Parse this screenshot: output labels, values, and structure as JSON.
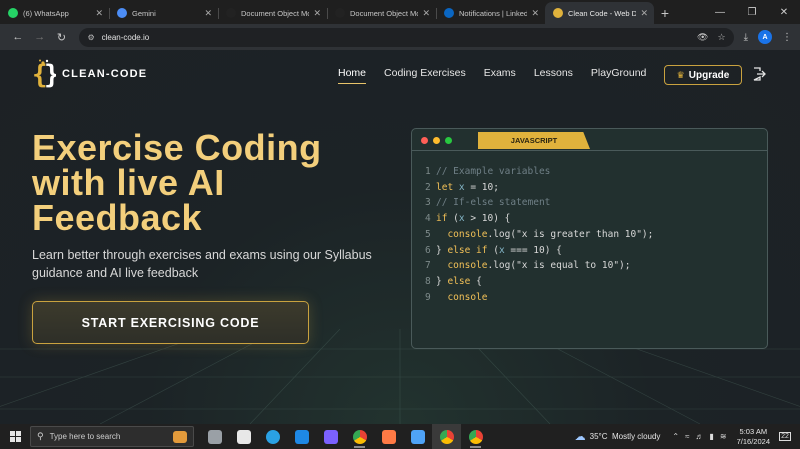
{
  "browser": {
    "tabs": [
      {
        "title": "(6) WhatsApp",
        "favicon": "whatsapp-icon",
        "color": "#25d366",
        "active": false
      },
      {
        "title": "Gemini",
        "favicon": "gemini-icon",
        "color": "#4c8df6",
        "active": false
      },
      {
        "title": "Document Object Mo",
        "favicon": "medium-icon",
        "color": "#222222",
        "active": false
      },
      {
        "title": "Document Object Mo",
        "favicon": "medium-icon",
        "color": "#222222",
        "active": false
      },
      {
        "title": "Notifications | Linked",
        "favicon": "linkedin-icon",
        "color": "#0a66c2",
        "active": false
      },
      {
        "title": "Clean Code - Web De",
        "favicon": "clean-code-icon",
        "color": "#e0b23c",
        "active": true
      }
    ],
    "url": "clean-code.io",
    "profile_initial": "A"
  },
  "site": {
    "logo_text": "CLEAN-CODE",
    "nav": [
      {
        "label": "Home",
        "active": true
      },
      {
        "label": "Coding Exercises",
        "active": false
      },
      {
        "label": "Exams",
        "active": false
      },
      {
        "label": "Lessons",
        "active": false
      },
      {
        "label": "PlayGround",
        "active": false
      }
    ],
    "upgrade_label": "Upgrade",
    "hero": {
      "title_lines": [
        "Exercise Coding",
        "with live AI",
        "Feedback"
      ],
      "subtitle": "Learn better through exercises and exams using our Syllabus guidance and AI live feedback",
      "cta_label": "START EXERCISING CODE"
    },
    "editor": {
      "language_tab": "JAVASCRIPT",
      "dots": [
        "#ff5f57",
        "#febc2e",
        "#28c840"
      ],
      "lines": [
        {
          "n": "1",
          "tokens": [
            {
              "t": "// Example variables",
              "c": "cm"
            }
          ]
        },
        {
          "n": "2",
          "tokens": [
            {
              "t": "let ",
              "c": "kw"
            },
            {
              "t": "x",
              "c": "vr"
            },
            {
              "t": " = 10;",
              "c": "st"
            }
          ]
        },
        {
          "n": "3",
          "tokens": [
            {
              "t": "// If-else statement",
              "c": "cm"
            }
          ]
        },
        {
          "n": "4",
          "tokens": [
            {
              "t": "if",
              "c": "kw"
            },
            {
              "t": " (",
              "c": "st"
            },
            {
              "t": "x",
              "c": "vr"
            },
            {
              "t": " > 10) {",
              "c": "st"
            }
          ]
        },
        {
          "n": "5",
          "tokens": [
            {
              "t": "  console",
              "c": "kw"
            },
            {
              "t": ".log(\"x is greater than 10\");",
              "c": "st"
            }
          ]
        },
        {
          "n": "6",
          "tokens": [
            {
              "t": "} ",
              "c": "st"
            },
            {
              "t": "else if",
              "c": "kw"
            },
            {
              "t": " (",
              "c": "st"
            },
            {
              "t": "x",
              "c": "vr"
            },
            {
              "t": " === 10) {",
              "c": "st"
            }
          ]
        },
        {
          "n": "7",
          "tokens": [
            {
              "t": "  console",
              "c": "kw"
            },
            {
              "t": ".log(\"x is equal to 10\");",
              "c": "st"
            }
          ]
        },
        {
          "n": "8",
          "tokens": [
            {
              "t": "} ",
              "c": "st"
            },
            {
              "t": "else",
              "c": "kw"
            },
            {
              "t": " {",
              "c": "st"
            }
          ]
        },
        {
          "n": "9",
          "tokens": [
            {
              "t": "  console",
              "c": "kw"
            }
          ]
        }
      ]
    },
    "accent_color": "#e0b23c"
  },
  "taskbar": {
    "search_placeholder": "Type here to search",
    "apps": [
      {
        "name": "task-view-icon",
        "color": "#9aa0a6",
        "state": ""
      },
      {
        "name": "microsoft-store-icon",
        "color": "#e8e8e8",
        "state": ""
      },
      {
        "name": "edge-icon",
        "color": "#2aa1e4",
        "state": ""
      },
      {
        "name": "mail-icon",
        "color": "#1e88e5",
        "state": ""
      },
      {
        "name": "media-player-icon",
        "color": "#7b61ff",
        "state": ""
      },
      {
        "name": "chrome-icon",
        "color": "#e94235",
        "state": "open"
      },
      {
        "name": "sublime-icon",
        "color": "#ff7a45",
        "state": ""
      },
      {
        "name": "app-icon",
        "color": "#4fa3f7",
        "state": ""
      },
      {
        "name": "chrome-icon",
        "color": "#e94235",
        "state": "active"
      },
      {
        "name": "chrome-icon",
        "color": "#e94235",
        "state": "open"
      }
    ],
    "weather_temp": "35°C",
    "weather_desc": "Mostly cloudy",
    "time": "5:03 AM",
    "date": "7/16/2024",
    "notification_count": "22"
  }
}
